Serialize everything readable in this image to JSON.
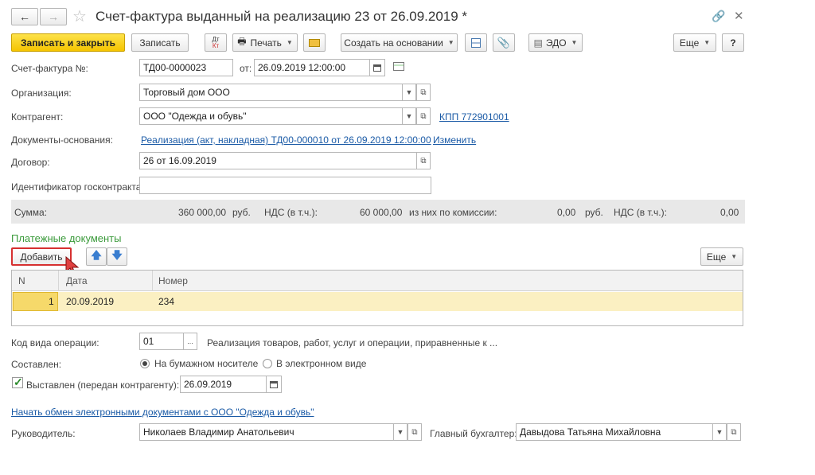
{
  "window": {
    "title": "Счет-фактура выданный на реализацию 23 от 26.09.2019 *"
  },
  "toolbar": {
    "save_close": "Записать и закрыть",
    "save": "Записать",
    "dt_kt_top": "Дт",
    "dt_kt_bottom": "Кт",
    "print": "Печать",
    "create_based": "Создать на основании",
    "edo": "ЭДО",
    "more": "Еще",
    "help": "?"
  },
  "form": {
    "invoice_label": "Счет-фактура №:",
    "invoice_number": "ТД00-0000023",
    "date_label": "от:",
    "date_value": "26.09.2019 12:00:00",
    "org_label": "Организация:",
    "org_value": "Торговый дом ООО",
    "contractor_label": "Контрагент:",
    "contractor_value": "ООО \"Одежда и обувь\"",
    "kpp_link": "КПП 772901001",
    "base_docs_label": "Документы-основания:",
    "base_docs_link": "Реализация (акт, накладная) ТД00-000010 от 26.09.2019 12:00:00",
    "change_link": "Изменить",
    "contract_label": "Договор:",
    "contract_value": "26 от 16.09.2019",
    "gov_contract_label": "Идентификатор госконтракта:",
    "gov_contract_value": ""
  },
  "summary": {
    "sum_label": "Сумма:",
    "sum_value": "360 000,00",
    "currency1": "руб.",
    "vat_label": "НДС (в т.ч.):",
    "vat_value": "60 000,00",
    "commission_label": "из них по комиссии:",
    "commission_value": "0,00",
    "currency2": "руб.",
    "vat2_label": "НДС (в т.ч.):",
    "vat2_value": "0,00"
  },
  "payments": {
    "section_title": "Платежные документы",
    "add_button": "Добавить",
    "more": "Еще",
    "columns": [
      "N",
      "Дата",
      "Номер"
    ],
    "rows": [
      {
        "n": "1",
        "date": "20.09.2019",
        "number": "234"
      }
    ]
  },
  "bottom": {
    "op_code_label": "Код вида операции:",
    "op_code_value": "01",
    "op_code_btn": "...",
    "op_code_desc": "Реализация товаров, работ, услуг и операции, приравненные к ...",
    "composed_label": "Составлен:",
    "paper_option": "На бумажном носителе",
    "electronic_option": "В электронном виде",
    "issued_label": "Выставлен (передан контрагенту):",
    "issued_date": "26.09.2019",
    "edo_link": "Начать обмен электронными документами с ООО \"Одежда и обувь\"",
    "director_label": "Руководитель:",
    "director_value": "Николаев Владимир Анатольевич",
    "accountant_label": "Главный бухгалтер:",
    "accountant_value": "Давыдова Татьяна Михайловна"
  },
  "colors": {
    "primary": "#f5c400",
    "link": "#1a5aa6",
    "section": "#3a9a3a",
    "highlight": "#fbf0c2"
  }
}
